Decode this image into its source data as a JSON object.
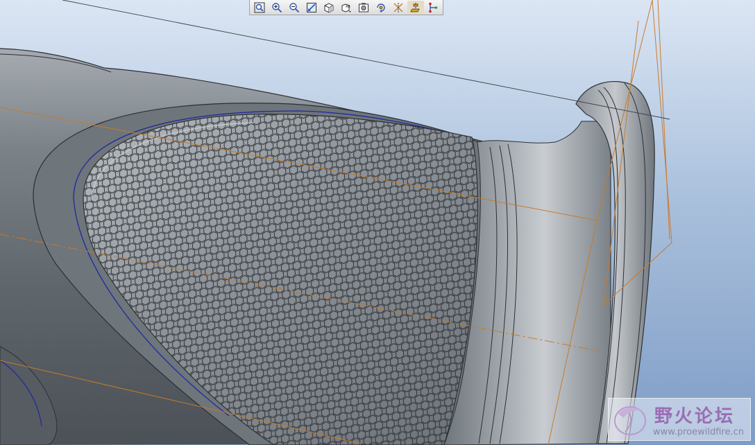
{
  "toolbar": {
    "buttons": [
      {
        "id": "refit",
        "icon": "zoom-fit-icon"
      },
      {
        "id": "zoom-in",
        "icon": "zoom-in-icon"
      },
      {
        "id": "zoom-out",
        "icon": "zoom-out-icon"
      },
      {
        "id": "repaint",
        "icon": "repaint-icon"
      },
      {
        "id": "display-style",
        "icon": "shaded-cube-icon"
      },
      {
        "id": "saved-views",
        "icon": "saved-views-icon"
      },
      {
        "id": "view-manager",
        "icon": "view-manager-icon"
      },
      {
        "id": "spin-center",
        "icon": "spin-center-icon"
      },
      {
        "id": "datum-planes",
        "icon": "datum-planes-icon"
      },
      {
        "id": "datum-axes",
        "icon": "datum-axes-icon"
      },
      {
        "id": "datum-points",
        "icon": "datum-points-icon"
      }
    ]
  },
  "colors": {
    "model": "#7d848b",
    "model_highlight": "#c3c8cd",
    "datum_plane": "#c87a2c",
    "curve": "#1e2a9c",
    "edge": "#2b2f33"
  },
  "watermark": {
    "title": "野火论坛",
    "url": "www.proewildfire.cn"
  }
}
